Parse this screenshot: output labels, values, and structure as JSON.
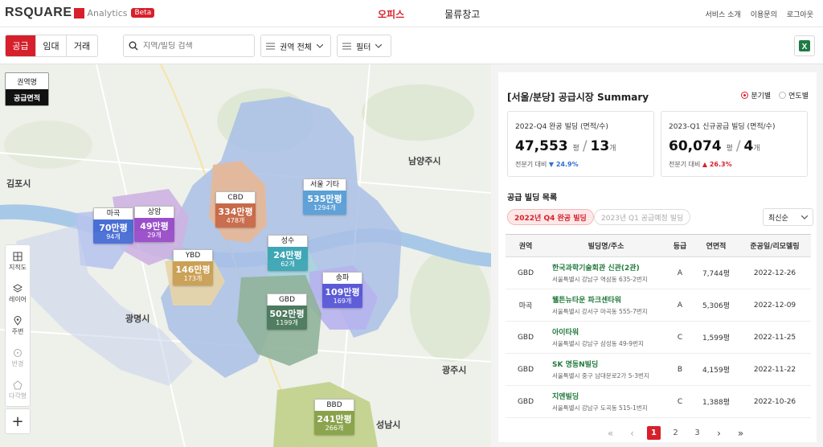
{
  "brand": {
    "logo_text": "RSQUARE",
    "sub": "Analytics",
    "beta": "Beta"
  },
  "nav": {
    "items": [
      "오피스",
      "물류창고"
    ],
    "active": 0
  },
  "top_links": [
    "서비스 소개",
    "이용문의",
    "로그아웃"
  ],
  "filters": {
    "segments": [
      "공급",
      "임대",
      "거래"
    ],
    "active_segment": 0,
    "search_placeholder": "지역/빌딩 검색",
    "region_dropdown": "권역 전체",
    "filter_dropdown": "필터"
  },
  "map": {
    "layer_options": [
      "권역명",
      "공급면적"
    ],
    "selected_layer": 1,
    "tools": [
      "지적도",
      "레이어",
      "주변",
      "반경",
      "다각형"
    ],
    "place_labels": [
      "김포시",
      "남양주시",
      "광명시",
      "광주시",
      "성남시"
    ],
    "markers": [
      {
        "name": "마곡",
        "value": "70만평",
        "count": "94개",
        "color": "#4a6fd4"
      },
      {
        "name": "상암",
        "value": "49만평",
        "count": "29개",
        "color": "#9a4fc9"
      },
      {
        "name": "CBD",
        "value": "334만평",
        "count": "478개",
        "color": "#c86a4a"
      },
      {
        "name": "서울 기타",
        "value": "535만평",
        "count": "1294개",
        "color": "#5ca0d6"
      },
      {
        "name": "YBD",
        "value": "146만평",
        "count": "173개",
        "color": "#caa055"
      },
      {
        "name": "성수",
        "value": "24만평",
        "count": "62개",
        "color": "#3fa6b5"
      },
      {
        "name": "송파",
        "value": "109만평",
        "count": "169개",
        "color": "#5a5ad6"
      },
      {
        "name": "GBD",
        "value": "502만평",
        "count": "1199개",
        "color": "#4d7a5e"
      },
      {
        "name": "BBD",
        "value": "241만평",
        "count": "266개",
        "color": "#8aa24a"
      }
    ]
  },
  "panel": {
    "title": "[서울/분당] 공급시장 Summary",
    "period_options": [
      "분기별",
      "연도별"
    ],
    "selected_period": 0,
    "stats": [
      {
        "label": "2022-Q4 완공 빌딩 (면적/수)",
        "area": "47,553",
        "area_unit": "평",
        "count": "13",
        "count_unit": "개",
        "change_label": "전분기 대비",
        "change": "▼ 24.9%",
        "direction": "down"
      },
      {
        "label": "2023-Q1 신규공급 빌딩 (면적/수)",
        "area": "60,074",
        "area_unit": "평",
        "count": "4",
        "count_unit": "개",
        "change_label": "전분기 대비",
        "change": "▲ 26.3%",
        "direction": "up"
      }
    ],
    "list_title": "공급 빌딩 목록",
    "chips": [
      "2022년 Q4 완공 빌딩",
      "2023년 Q1 공급예정 빌딩"
    ],
    "sort": "최신순",
    "columns": [
      "권역",
      "빌딩명/주소",
      "등급",
      "연면적",
      "준공일/리모델링"
    ],
    "rows": [
      {
        "region": "GBD",
        "name": "한국과학기술회관 신관(2관)",
        "addr": "서울특별시 강남구 역삼동 635-2번지",
        "grade": "A",
        "area": "7,744평",
        "date": "2022-12-26"
      },
      {
        "region": "마곡",
        "name": "웰튼뉴타운 파크센타워",
        "addr": "서울특별시 강서구 마곡동 555-7번지",
        "grade": "A",
        "area": "5,306평",
        "date": "2022-12-09"
      },
      {
        "region": "GBD",
        "name": "아이타워",
        "addr": "서울특별시 강남구 삼성동 49-9번지",
        "grade": "C",
        "area": "1,599평",
        "date": "2022-11-25"
      },
      {
        "region": "GBD",
        "name": "SK 명동N빌딩",
        "addr": "서울특별시 중구 남대문로2가 5-3번지",
        "grade": "B",
        "area": "4,159평",
        "date": "2022-11-22"
      },
      {
        "region": "GBD",
        "name": "지엔빌딩",
        "addr": "서울특별시 강남구 도곡동 515-1번지",
        "grade": "C",
        "area": "1,388평",
        "date": "2022-10-26"
      }
    ],
    "pages": [
      "1",
      "2",
      "3"
    ],
    "current_page": "1"
  }
}
